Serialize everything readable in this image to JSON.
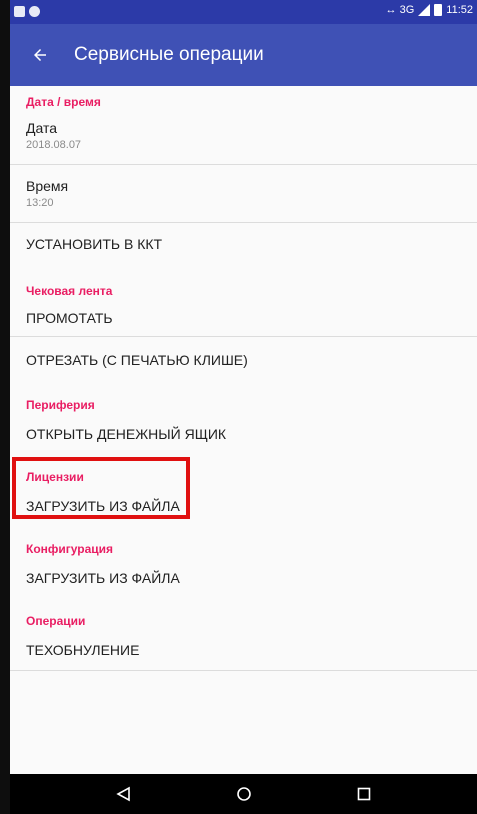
{
  "statusbar": {
    "network": "↔ 3G",
    "time": "11:52"
  },
  "appbar": {
    "title": "Сервисные операции",
    "back_icon": "arrow-left-icon"
  },
  "sections": {
    "datetime": {
      "label": "Дата / время",
      "date_title": "Дата",
      "date_value": "2018.08.07",
      "time_title": "Время",
      "time_value": "13:20",
      "set_kkt": "УСТАНОВИТЬ В ККТ"
    },
    "receipt_tape": {
      "label": "Чековая лента",
      "feed": "ПРОМОТАТЬ",
      "cut": "ОТРЕЗАТЬ (С ПЕЧАТЬЮ КЛИШЕ)"
    },
    "periphery": {
      "label": "Периферия",
      "open_drawer": "ОТКРЫТЬ ДЕНЕЖНЫЙ ЯЩИК"
    },
    "licenses": {
      "label": "Лицензии",
      "load_from_file": "ЗАГРУЗИТЬ ИЗ ФАЙЛА"
    },
    "configuration": {
      "label": "Конфигурация",
      "load_from_file": "ЗАГРУЗИТЬ ИЗ ФАЙЛА"
    },
    "operations": {
      "label": "Операции",
      "tech_reset": "ТЕХОБНУЛЕНИЕ"
    }
  },
  "colors": {
    "appbar": "#3f51b5",
    "statusbar": "#2c3aa8",
    "section_label": "#e91e63",
    "highlight": "#e01010"
  }
}
